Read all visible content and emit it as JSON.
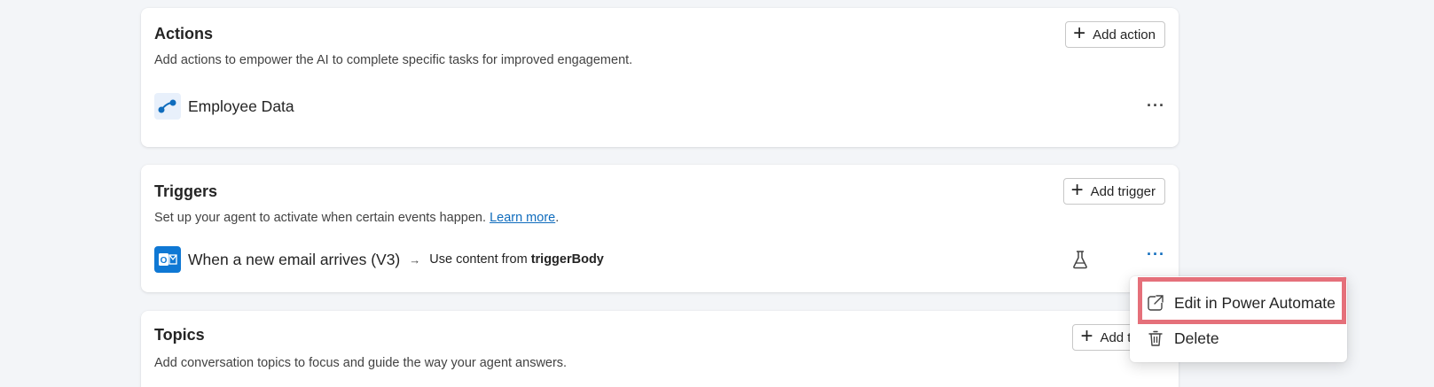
{
  "actions": {
    "title": "Actions",
    "description": "Add actions to empower the AI to complete specific tasks for improved engagement.",
    "add_label": "Add action",
    "items": [
      {
        "name": "Employee Data",
        "icon": "flow-icon"
      }
    ]
  },
  "triggers": {
    "title": "Triggers",
    "description": "Set up your agent to activate when certain events happen.",
    "learn_more": "Learn more",
    "period": ".",
    "add_label": "Add trigger",
    "items": [
      {
        "name": "When a new email arrives (V3)",
        "arrow": "→",
        "use_content_prefix": "Use content from",
        "use_content_value": "triggerBody",
        "icon": "outlook-icon"
      }
    ]
  },
  "topics": {
    "title": "Topics",
    "description": "Add conversation topics to focus and guide the way your agent answers.",
    "add_label": "Add topic"
  },
  "context_menu": {
    "items": [
      {
        "label": "Edit in Power Automate",
        "icon": "open-external-icon"
      },
      {
        "label": "Delete",
        "icon": "trash-icon"
      }
    ]
  },
  "more_glyph": "···",
  "plus_glyph": "+",
  "colors": {
    "accent": "#0f6cbd",
    "highlight": "#e5707a",
    "outlook": "#0f78d4"
  }
}
